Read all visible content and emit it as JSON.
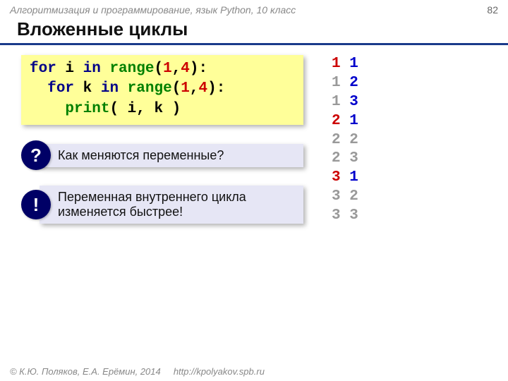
{
  "header": {
    "course": "Алгоритмизация и программирование, язык Python, 10 класс",
    "page": "82"
  },
  "title": "Вложенные циклы",
  "code": {
    "l1": {
      "for": "for",
      "var": " i ",
      "in": "in",
      "sp": " ",
      "range": "range",
      "open": "(",
      "a": "1",
      "comma": ",",
      "b": "4",
      "close": "):"
    },
    "l2": {
      "indent": "  ",
      "for": "for",
      "var": " k ",
      "in": "in",
      "sp": " ",
      "range": "range",
      "open": "(",
      "a": "1",
      "comma": ",",
      "b": "4",
      "close": "):"
    },
    "l3": {
      "indent": "    ",
      "print": "print",
      "args": "( i, k )"
    }
  },
  "output": [
    {
      "i": "1",
      "k": "1",
      "ic": "c-red",
      "kc": "c-blue"
    },
    {
      "i": "1",
      "k": "2",
      "ic": "c-gray",
      "kc": "c-blue"
    },
    {
      "i": "1",
      "k": "3",
      "ic": "c-gray",
      "kc": "c-blue"
    },
    {
      "i": "2",
      "k": "1",
      "ic": "c-red",
      "kc": "c-blue"
    },
    {
      "i": "2",
      "k": "2",
      "ic": "c-gray",
      "kc": "c-gray"
    },
    {
      "i": "2",
      "k": "3",
      "ic": "c-gray",
      "kc": "c-gray"
    },
    {
      "i": "3",
      "k": "1",
      "ic": "c-red",
      "kc": "c-blue"
    },
    {
      "i": "3",
      "k": "2",
      "ic": "c-gray",
      "kc": "c-gray"
    },
    {
      "i": "3",
      "k": "3",
      "ic": "c-gray",
      "kc": "c-gray"
    }
  ],
  "callouts": {
    "question": {
      "badge": "?",
      "text": "Как меняются переменные?"
    },
    "note": {
      "badge": "!",
      "text": "Переменная внутреннего цикла изменяется быстрее!"
    }
  },
  "footer": {
    "copyright": "© К.Ю. Поляков, Е.А. Ерёмин, 2014",
    "url": "http://kpolyakov.spb.ru"
  }
}
